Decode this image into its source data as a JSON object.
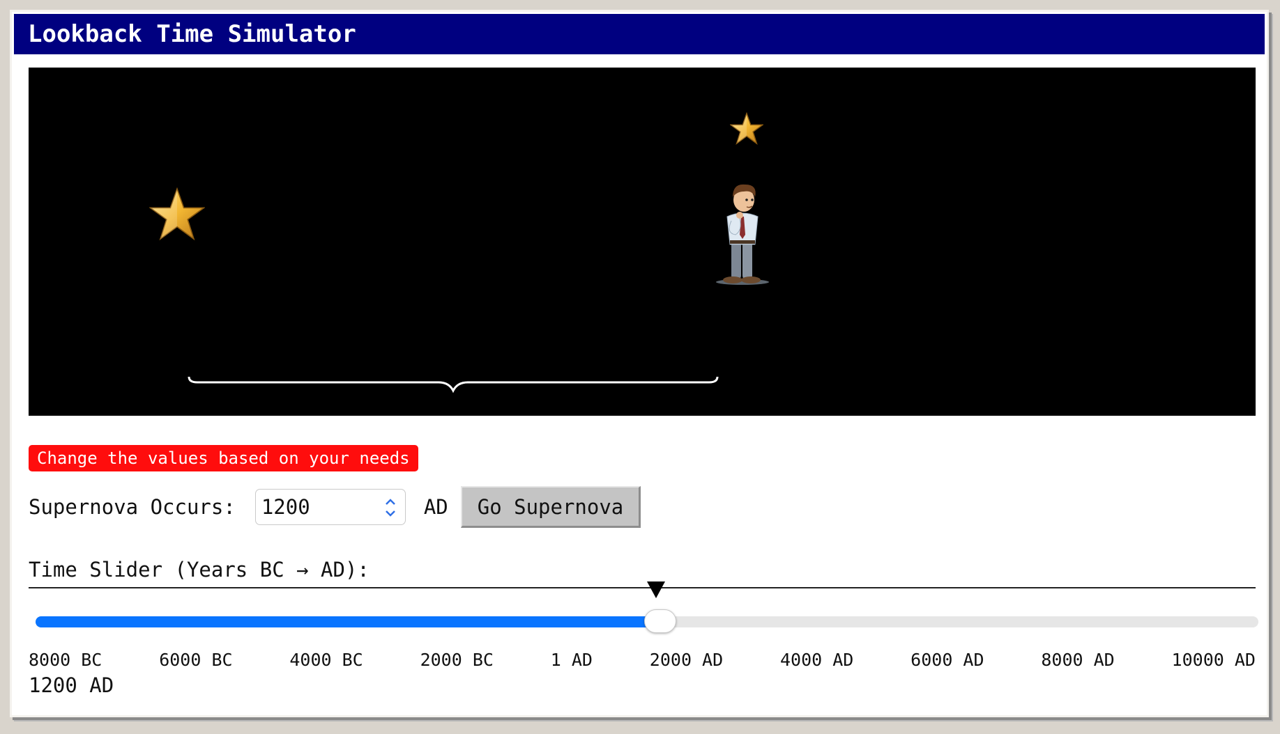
{
  "window": {
    "title": "Lookback Time Simulator"
  },
  "scene": {
    "objects": [
      {
        "name": "distant-star",
        "icon": "star-icon"
      },
      {
        "name": "nearby-star",
        "icon": "star-icon"
      },
      {
        "name": "observer",
        "icon": "thinking-man-icon"
      },
      {
        "name": "distance-brace",
        "icon": "curly-brace-icon"
      }
    ]
  },
  "controls": {
    "notice": "Change the values based on your needs",
    "supernova_label": "Supernova Occurs:",
    "supernova_value": "1200",
    "supernova_unit": "AD",
    "go_button": "Go Supernova"
  },
  "slider": {
    "label": "Time Slider (Years BC → AD):",
    "min_year": -8000,
    "max_year": 10000,
    "value_year": 1200,
    "marker_year": 1200,
    "ticks": [
      "8000 BC",
      "6000 BC",
      "4000 BC",
      "2000 BC",
      "1 AD",
      "2000 AD",
      "4000 AD",
      "6000 AD",
      "8000 AD",
      "10000 AD"
    ],
    "readout": "1200 AD"
  },
  "colors": {
    "titlebar": "#000080",
    "notice": "#ff0d0d",
    "slider_fill": "#0a75ff",
    "sky": "#000000"
  }
}
